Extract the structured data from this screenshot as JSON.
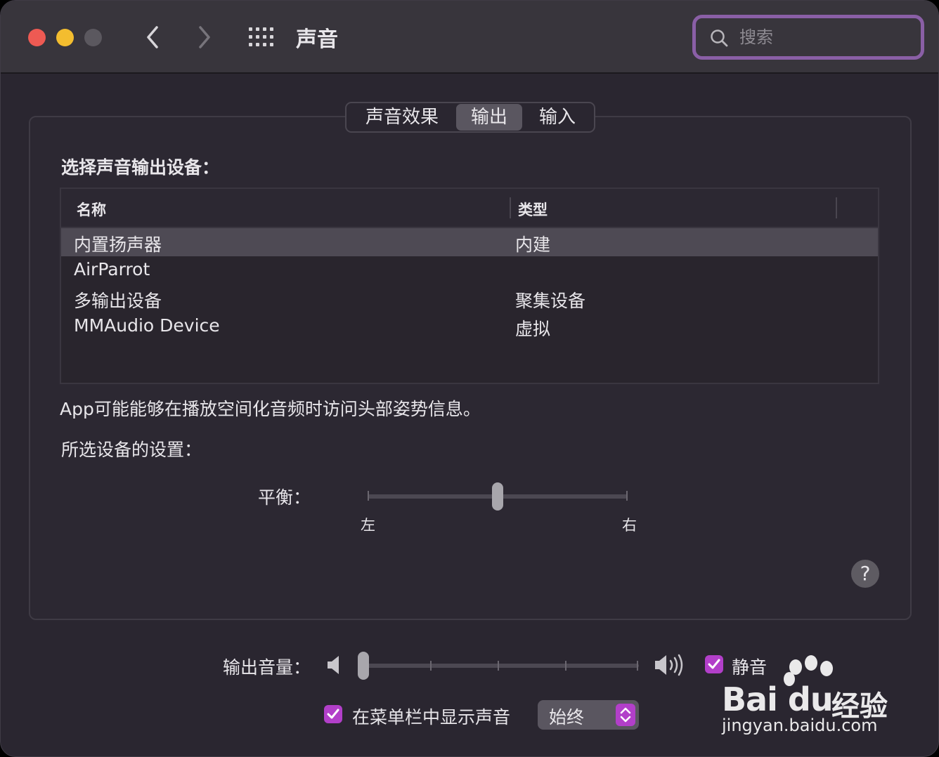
{
  "window": {
    "title": "声音",
    "search": {
      "placeholder": "搜索",
      "value": ""
    }
  },
  "tabs": [
    {
      "label": "声音效果",
      "selected": false
    },
    {
      "label": "输出",
      "selected": true
    },
    {
      "label": "输入",
      "selected": false
    }
  ],
  "output": {
    "section_label": "选择声音输出设备：",
    "columns": {
      "name": "名称",
      "type": "类型"
    },
    "devices": [
      {
        "name": "内置扬声器",
        "type": "内建",
        "selected": true
      },
      {
        "name": "AirParrot",
        "type": "",
        "selected": false
      },
      {
        "name": "多输出设备",
        "type": "聚集设备",
        "selected": false
      },
      {
        "name": "MMAudio Device",
        "type": "虚拟",
        "selected": false
      }
    ],
    "info_text": "App可能能够在播放空间化音频时访问头部姿势信息。",
    "settings_label": "所选设备的设置：",
    "balance": {
      "label": "平衡：",
      "left_label": "左",
      "right_label": "右",
      "value": 0.5
    }
  },
  "help": {
    "label": "?"
  },
  "volume": {
    "label": "输出音量：",
    "value": 0.0,
    "mute": {
      "label": "静音",
      "checked": true
    }
  },
  "menubar": {
    "label": "在菜单栏中显示声音",
    "checked": true,
    "option": "始终"
  },
  "watermark": {
    "brand": "Bai du",
    "suffix": "经验",
    "url": "jingyan.baidu.com"
  },
  "colors": {
    "accent": "#b23fc9",
    "search_focus": "#8a5fa6",
    "close": "#ee5a53",
    "minimize": "#f3bd2f"
  }
}
